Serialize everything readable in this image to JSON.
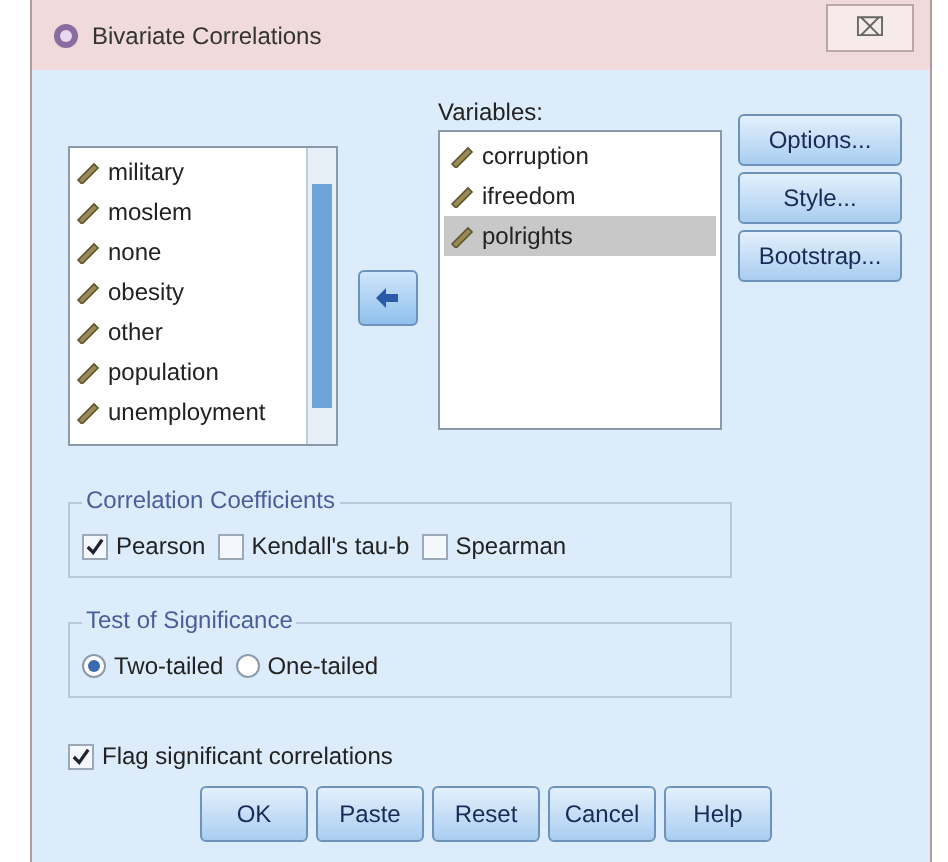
{
  "window": {
    "title": "Bivariate Correlations",
    "close": "⌧"
  },
  "source_list": {
    "items": [
      {
        "label": "military",
        "selected": false
      },
      {
        "label": "moslem",
        "selected": false
      },
      {
        "label": "none",
        "selected": false
      },
      {
        "label": "obesity",
        "selected": false
      },
      {
        "label": "other",
        "selected": false
      },
      {
        "label": "population",
        "selected": false
      },
      {
        "label": "unemployment",
        "selected": false
      }
    ]
  },
  "variables": {
    "label": "Variables:",
    "items": [
      {
        "label": "corruption",
        "selected": false
      },
      {
        "label": "ifreedom",
        "selected": false
      },
      {
        "label": "polrights",
        "selected": true
      }
    ]
  },
  "side_buttons": [
    "Options...",
    "Style...",
    "Bootstrap..."
  ],
  "coefficients": {
    "title": "Correlation Coefficients",
    "options": [
      {
        "label": "Pearson",
        "checked": true
      },
      {
        "label": "Kendall's tau-b",
        "checked": false
      },
      {
        "label": "Spearman",
        "checked": false
      }
    ]
  },
  "significance": {
    "title": "Test of Significance",
    "options": [
      {
        "label": "Two-tailed",
        "selected": true
      },
      {
        "label": "One-tailed",
        "selected": false
      }
    ]
  },
  "flag": {
    "label": "Flag significant correlations",
    "checked": true
  },
  "buttons": [
    "OK",
    "Paste",
    "Reset",
    "Cancel",
    "Help"
  ]
}
